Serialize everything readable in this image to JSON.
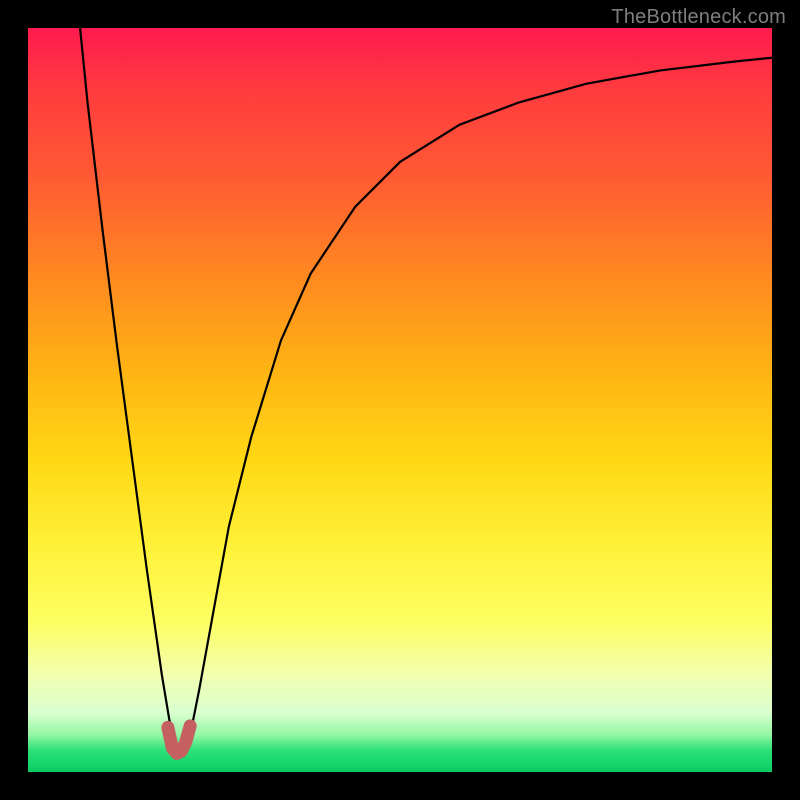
{
  "watermark": "TheBottleneck.com",
  "colors": {
    "curve_stroke": "#000000",
    "marker_stroke": "#c46160",
    "frame_bg": "#000000"
  },
  "chart_data": {
    "type": "line",
    "title": "",
    "xlabel": "",
    "ylabel": "",
    "xlim": [
      0,
      100
    ],
    "ylim": [
      0,
      100
    ],
    "series": [
      {
        "name": "curve",
        "x": [
          7,
          8,
          10,
          12,
          14,
          16,
          17,
          18,
          19,
          20,
          21,
          22,
          23,
          25,
          27,
          30,
          34,
          38,
          44,
          50,
          58,
          66,
          75,
          85,
          95,
          100
        ],
        "y": [
          100,
          90,
          73,
          57,
          42,
          27,
          20,
          13,
          7,
          3,
          3,
          6,
          11,
          22,
          33,
          45,
          58,
          67,
          76,
          82,
          87,
          90,
          92.5,
          94.3,
          95.5,
          96
        ]
      }
    ],
    "marker": {
      "name": "highlight",
      "x": [
        18.8,
        19.4,
        20.0,
        20.6,
        21.2,
        21.8
      ],
      "y": [
        6.0,
        3.2,
        2.5,
        2.8,
        4.0,
        6.2
      ]
    }
  }
}
